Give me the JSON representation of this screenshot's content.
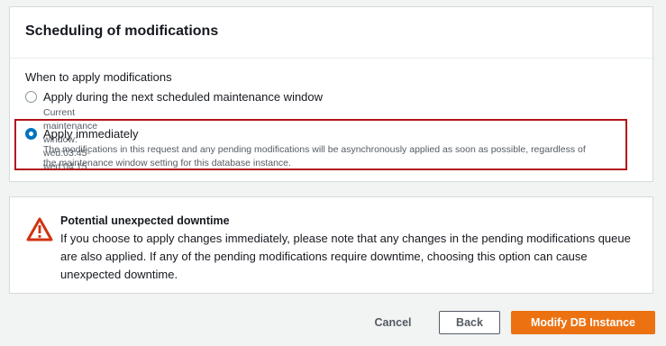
{
  "panel": {
    "title": "Scheduling of modifications",
    "section_label": "When to apply modifications",
    "options": [
      {
        "title": "Apply during the next scheduled maintenance window",
        "description": "Current maintenance window: wed:03:45-wed:04:15",
        "selected": false
      },
      {
        "title": "Apply immediately",
        "description_line1": "The modifications in this request and any pending modifications will be asynchronously applied as soon as possible, regardless of",
        "description_line2": "the maintenance window setting for this database instance.",
        "selected": true
      }
    ]
  },
  "alert": {
    "icon": "warning-icon",
    "title": "Potential unexpected downtime",
    "body": "If you choose to apply changes immediately, please note that any changes in the pending modifications queue are also applied. If any of the pending modifications require downtime, choosing this option can cause unexpected downtime."
  },
  "actions": {
    "cancel": "Cancel",
    "back": "Back",
    "modify": "Modify DB Instance"
  },
  "colors": {
    "primary": "#ec7211",
    "radio_selected": "#0073bb",
    "warning": "#d13212",
    "highlight_border": "#b3141a"
  }
}
